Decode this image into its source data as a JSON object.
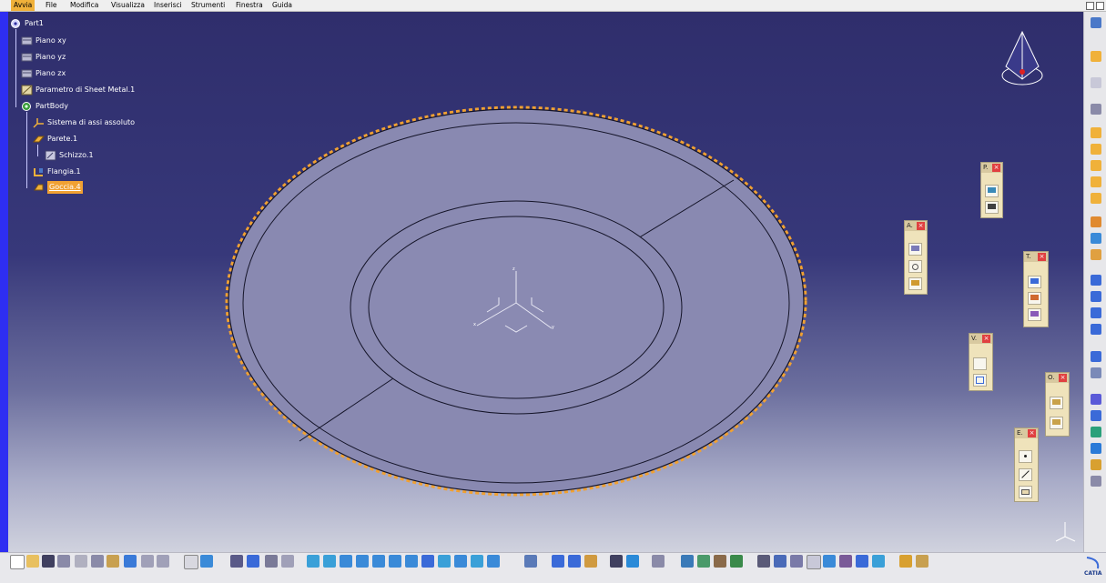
{
  "menu": {
    "items": [
      {
        "label": "Avvia"
      },
      {
        "label": "File"
      },
      {
        "label": "Modifica"
      },
      {
        "label": "Visualizza"
      },
      {
        "label": "Inserisci"
      },
      {
        "label": "Strumenti"
      },
      {
        "label": "Finestra"
      },
      {
        "label": "Guida"
      }
    ]
  },
  "tree": {
    "root": "Part1",
    "nodes": [
      {
        "label": "Piano xy",
        "icon": "plane-icon"
      },
      {
        "label": "Piano yz",
        "icon": "plane-icon"
      },
      {
        "label": "Piano zx",
        "icon": "plane-icon"
      },
      {
        "label": "Parametro di Sheet Metal.1",
        "icon": "sheet-metal-parameters-icon"
      },
      {
        "label": "PartBody",
        "icon": "part-body-icon"
      },
      {
        "label": "Sistema di assi assoluto",
        "icon": "axis-system-icon"
      },
      {
        "label": "Parete.1",
        "icon": "wall-icon"
      },
      {
        "label": "Schizzo.1",
        "icon": "sketch-icon"
      },
      {
        "label": "Flangia.1",
        "icon": "flange-icon"
      },
      {
        "label": "Goccia.4",
        "icon": "tear-drop-icon",
        "selected": true
      }
    ]
  },
  "floating_toolbars": [
    {
      "title": "P.",
      "icons": [
        "tooltip-icon",
        "save-icon"
      ]
    },
    {
      "title": "A.",
      "icons": [
        "sketch-analysis-icon",
        "selection-icon",
        "edit-icon"
      ]
    },
    {
      "title": "T.",
      "icons": [
        "tool-a-icon",
        "pattern-icon",
        "tool-b-icon"
      ]
    },
    {
      "title": "V.",
      "icons": [
        "view-empty-icon",
        "view-box-icon"
      ]
    },
    {
      "title": "O.",
      "icons": [
        "object-a-icon",
        "object-b-icon"
      ]
    },
    {
      "title": "E.",
      "icons": [
        "point-icon",
        "line-icon",
        "plane-tool-icon"
      ]
    }
  ],
  "close_glyph": "×",
  "colors": {
    "selection_orange": "#f0a133",
    "tree_text": "#ffffff",
    "part_fill": "#8a8ab3",
    "edge": "#101020"
  },
  "brand": {
    "text": "CATIA"
  }
}
